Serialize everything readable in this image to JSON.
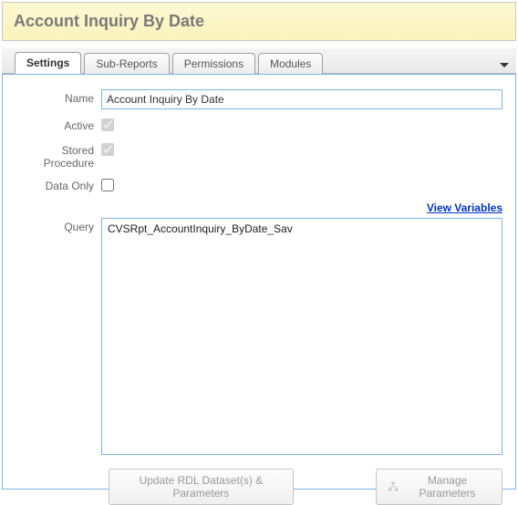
{
  "header": {
    "title": "Account Inquiry By Date"
  },
  "tabs": {
    "items": [
      {
        "label": "Settings",
        "active": true
      },
      {
        "label": "Sub-Reports",
        "active": false
      },
      {
        "label": "Permissions",
        "active": false
      },
      {
        "label": "Modules",
        "active": false
      }
    ]
  },
  "form": {
    "name_label": "Name",
    "name_value": "Account Inquiry By Date",
    "active_label": "Active",
    "active_checked": true,
    "stored_proc_label": "Stored Procedure",
    "stored_proc_checked": true,
    "data_only_label": "Data Only",
    "data_only_checked": false,
    "view_variables_label": "View Variables",
    "query_label": "Query",
    "query_value": "CVSRpt_AccountInquiry_ByDate_Sav"
  },
  "buttons": {
    "update_rdl": "Update RDL Dataset(s) & Parameters",
    "manage_params": "Manage Parameters"
  }
}
